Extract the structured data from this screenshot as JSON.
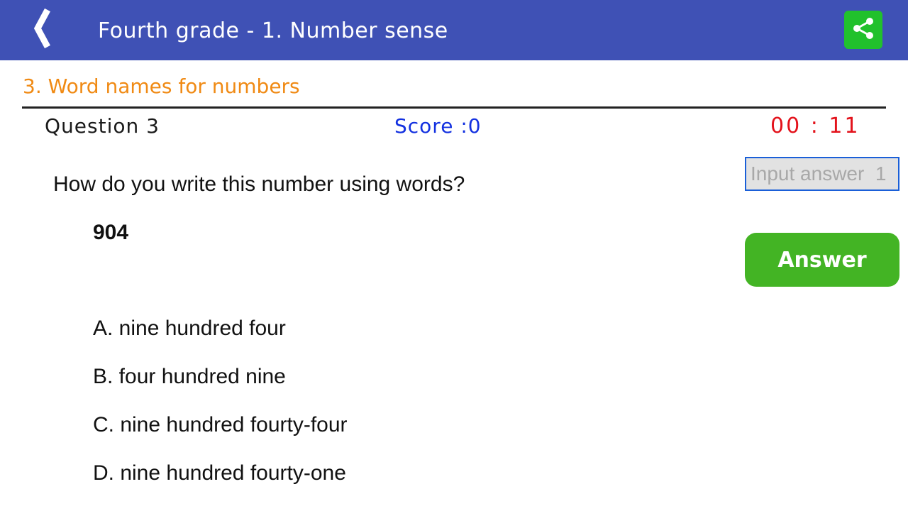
{
  "header": {
    "title": "Fourth grade - 1. Number sense",
    "back_icon": "back-chevron-icon",
    "share_icon": "share-icon",
    "bar_color": "#3f51b5",
    "share_color": "#21c12c"
  },
  "section": {
    "title": "3. Word names for numbers",
    "color": "#f08a14"
  },
  "status": {
    "question_label": "Question 3",
    "score_label": "Score :0",
    "timer": "00 : 11"
  },
  "answer_input": {
    "placeholder": "Input answer  1",
    "value": ""
  },
  "answer_button": {
    "label": "Answer",
    "color": "#43b424"
  },
  "question": {
    "text": "How do you write this number using words?",
    "number": "904",
    "options": [
      "A. nine hundred four",
      "B. four hundred nine",
      "C. nine hundred fourty-four",
      "D. nine hundred fourty-one"
    ]
  }
}
